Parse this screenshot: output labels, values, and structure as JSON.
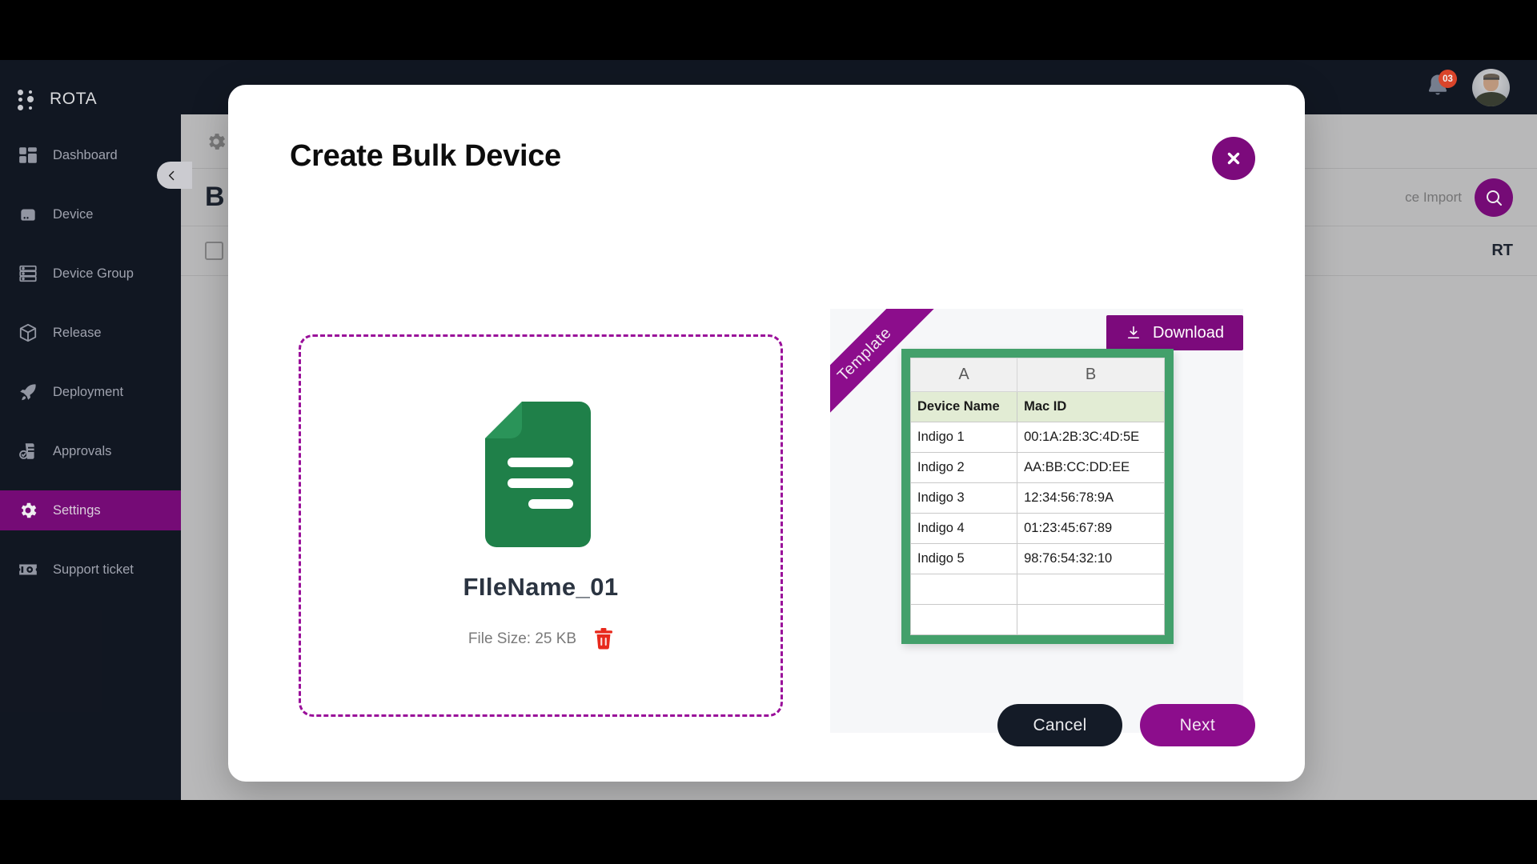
{
  "brand": {
    "name": "ROTA",
    "logo_icon": "dots-grid-icon"
  },
  "sidebar": {
    "collapse_icon": "chevron-left-icon",
    "items": [
      {
        "label": "Dashboard",
        "icon": "dashboard-icon",
        "active": false
      },
      {
        "label": "Device",
        "icon": "device-icon",
        "active": false
      },
      {
        "label": "Device Group",
        "icon": "device-group-icon",
        "active": false
      },
      {
        "label": "Release",
        "icon": "box-icon",
        "active": false
      },
      {
        "label": "Deployment",
        "icon": "rocket-icon",
        "active": false
      },
      {
        "label": "Approvals",
        "icon": "approvals-icon",
        "active": false
      },
      {
        "label": "Settings",
        "icon": "gear-icon",
        "active": true
      },
      {
        "label": "Support ticket",
        "icon": "support-ticket-icon",
        "active": false
      }
    ]
  },
  "topbar": {
    "notification_icon": "bell-icon",
    "notification_count": "03",
    "avatar_icon": "user-avatar"
  },
  "background_page": {
    "settings_icon": "gear-icon",
    "title": "B",
    "search_placeholder": "ce Import",
    "search_icon": "search-icon",
    "select_all_checkbox": "checkbox-icon",
    "column_label": "RT"
  },
  "modal": {
    "title": "Create Bulk Device",
    "close_icon": "close-icon",
    "dropzone": {
      "file_icon": "document-file-icon",
      "file_name": "FIleName_01",
      "file_size_label": "File Size: 25 KB",
      "delete_icon": "trash-icon"
    },
    "template": {
      "ribbon_label": "Template",
      "download_label": "Download",
      "download_icon": "download-icon",
      "columns": [
        "A",
        "B"
      ],
      "headers": [
        "Device Name",
        "Mac ID"
      ],
      "rows": [
        [
          "Indigo 1",
          "00:1A:2B:3C:4D:5E"
        ],
        [
          "Indigo 2",
          "AA:BB:CC:DD:EE"
        ],
        [
          "Indigo 3",
          "12:34:56:78:9A"
        ],
        [
          "Indigo 4",
          "01:23:45:67:89"
        ],
        [
          "Indigo 5",
          "98:76:54:32:10"
        ],
        [
          "",
          ""
        ],
        [
          "",
          ""
        ]
      ]
    },
    "footer": {
      "cancel_label": "Cancel",
      "next_label": "Next"
    }
  },
  "colors": {
    "accent_purple": "#7c0a7c",
    "dark_navy": "#111722",
    "sheet_green": "#43a06b",
    "file_green": "#1f8049",
    "trash_red": "#e8291c",
    "badge_red": "#e8482a"
  }
}
